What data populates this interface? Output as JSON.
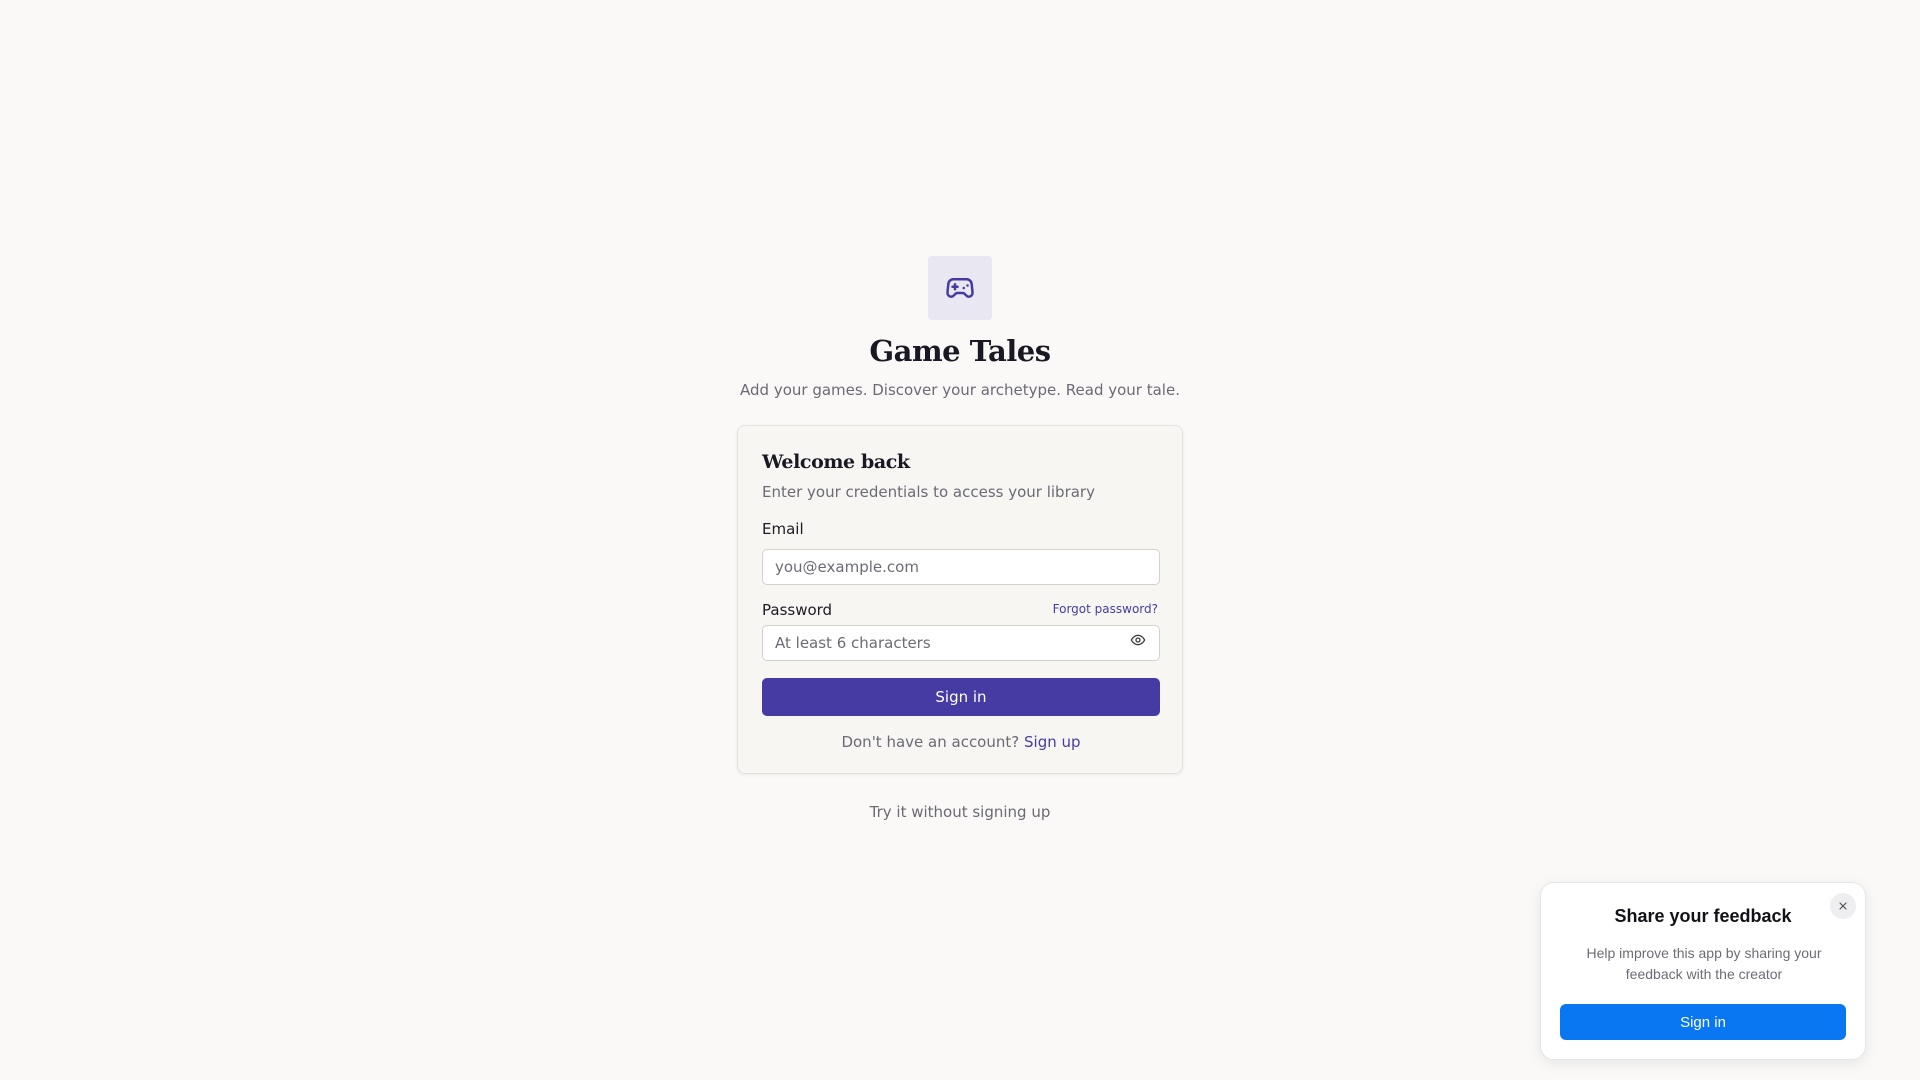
{
  "brand": {
    "icon": "gamepad-icon",
    "title": "Game Tales",
    "tagline": "Add your games. Discover your archetype. Read your tale."
  },
  "login_card": {
    "title": "Welcome back",
    "subtitle": "Enter your credentials to access your library",
    "email": {
      "label": "Email",
      "value": "",
      "placeholder": "you@example.com"
    },
    "password": {
      "label": "Password",
      "value": "",
      "placeholder": "At least 6 characters",
      "forgot_label": "Forgot password?",
      "toggle_icon": "eye-icon"
    },
    "submit_label": "Sign in",
    "signup_prompt": "Don't have an account?",
    "signup_link": "Sign up"
  },
  "guest_link": "Try it without signing up",
  "feedback_popup": {
    "title": "Share your feedback",
    "text": "Help improve this app by sharing your feedback with the creator",
    "button_label": "Sign in",
    "close_icon": "close-icon"
  },
  "colors": {
    "background": "#faf9f7",
    "accent": "#463ba3",
    "link": "#463d9f",
    "feedback_button": "#0a77f2"
  }
}
